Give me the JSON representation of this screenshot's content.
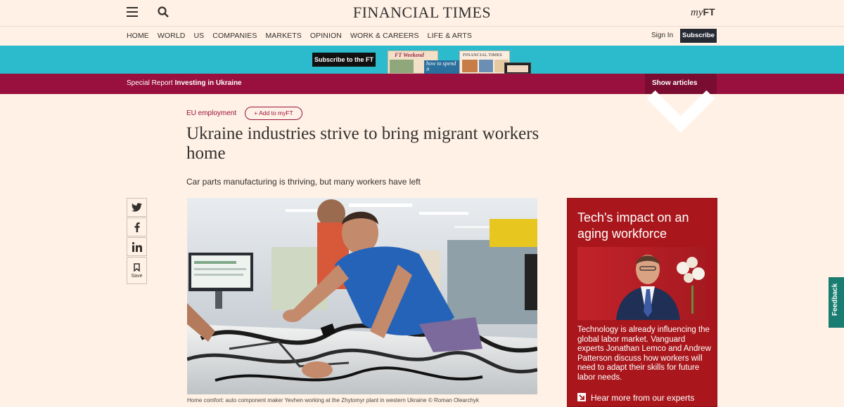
{
  "header": {
    "logo": "FINANCIAL TIMES",
    "myft_prefix": "my",
    "myft_suffix": "FT"
  },
  "nav": {
    "items": [
      "HOME",
      "WORLD",
      "US",
      "COMPANIES",
      "MARKETS",
      "OPINION",
      "WORK & CAREERS",
      "LIFE & ARTS"
    ],
    "signin": "Sign In",
    "subscribe": "Subscribe"
  },
  "banner": {
    "button": "Subscribe to the FT",
    "promo_weekend": "FT Weekend",
    "promo_how": "how to spend it",
    "promo_ft": "FINANCIAL TIMES"
  },
  "special_report": {
    "prefix": "Special Report",
    "name": "Investing in Ukraine",
    "show_articles": "Show articles"
  },
  "article": {
    "topic": "EU employment",
    "add_myft": "Add to myFT",
    "headline": "Ukraine industries strive to bring migrant workers home",
    "standfirst": "Car parts manufacturing is thriving, but many workers have left",
    "caption": "Home comfort: auto component maker Yevhen working at the Zhytomyr plant in western Ukraine © Roman Olearchyk"
  },
  "share": {
    "items": [
      "twitter-icon",
      "facebook-icon",
      "linkedin-icon",
      "bookmark-icon"
    ],
    "save_label": "Save"
  },
  "ad": {
    "title": "Tech's impact on an aging workforce",
    "body": "Technology is already influencing the global labor market. Vanguard experts Jonathan Lemco and Andrew Patterson discuss how workers will need to adapt their skills for future labor needs.",
    "cta": "Hear more from our experts"
  },
  "feedback": "Feedback",
  "colors": {
    "page_bg": "#fff1e5",
    "claret": "#990f3d",
    "banner_teal": "#2bbbcc",
    "ad_red": "#a9171c",
    "feedback_teal": "#1a7d71"
  }
}
